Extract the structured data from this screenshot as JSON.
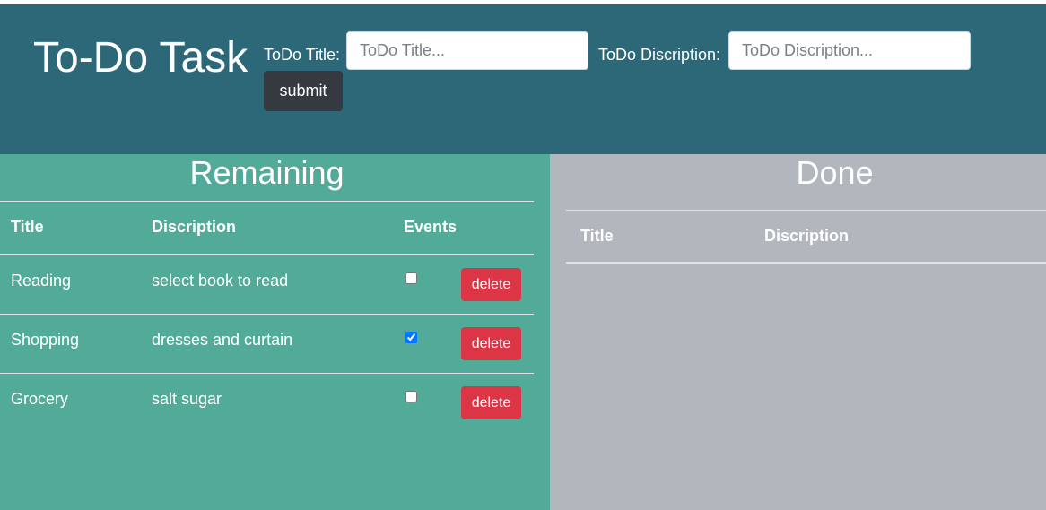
{
  "header": {
    "app_title": "To-Do Task",
    "title_label": "ToDo Title:",
    "title_placeholder": "ToDo Title...",
    "title_value": "",
    "description_label": "ToDo Discription:",
    "description_placeholder": "ToDo Discription...",
    "description_value": "",
    "submit_label": "submit"
  },
  "remaining": {
    "heading": "Remaining",
    "columns": [
      "Title",
      "Discription",
      "Events"
    ],
    "rows": [
      {
        "title": "Reading",
        "description": "select book to read",
        "checked": false,
        "delete_label": "delete"
      },
      {
        "title": "Shopping",
        "description": "dresses and curtain",
        "checked": true,
        "delete_label": "delete"
      },
      {
        "title": "Grocery",
        "description": "salt sugar",
        "checked": false,
        "delete_label": "delete"
      }
    ]
  },
  "done": {
    "heading": "Done",
    "columns": [
      "Title",
      "Discription"
    ],
    "rows": []
  },
  "colors": {
    "header_bg": "#2c6878",
    "remaining_bg": "#52aa98",
    "done_bg": "#b2b6bd",
    "submit_bg": "#343a40",
    "delete_bg": "#dc3545"
  }
}
